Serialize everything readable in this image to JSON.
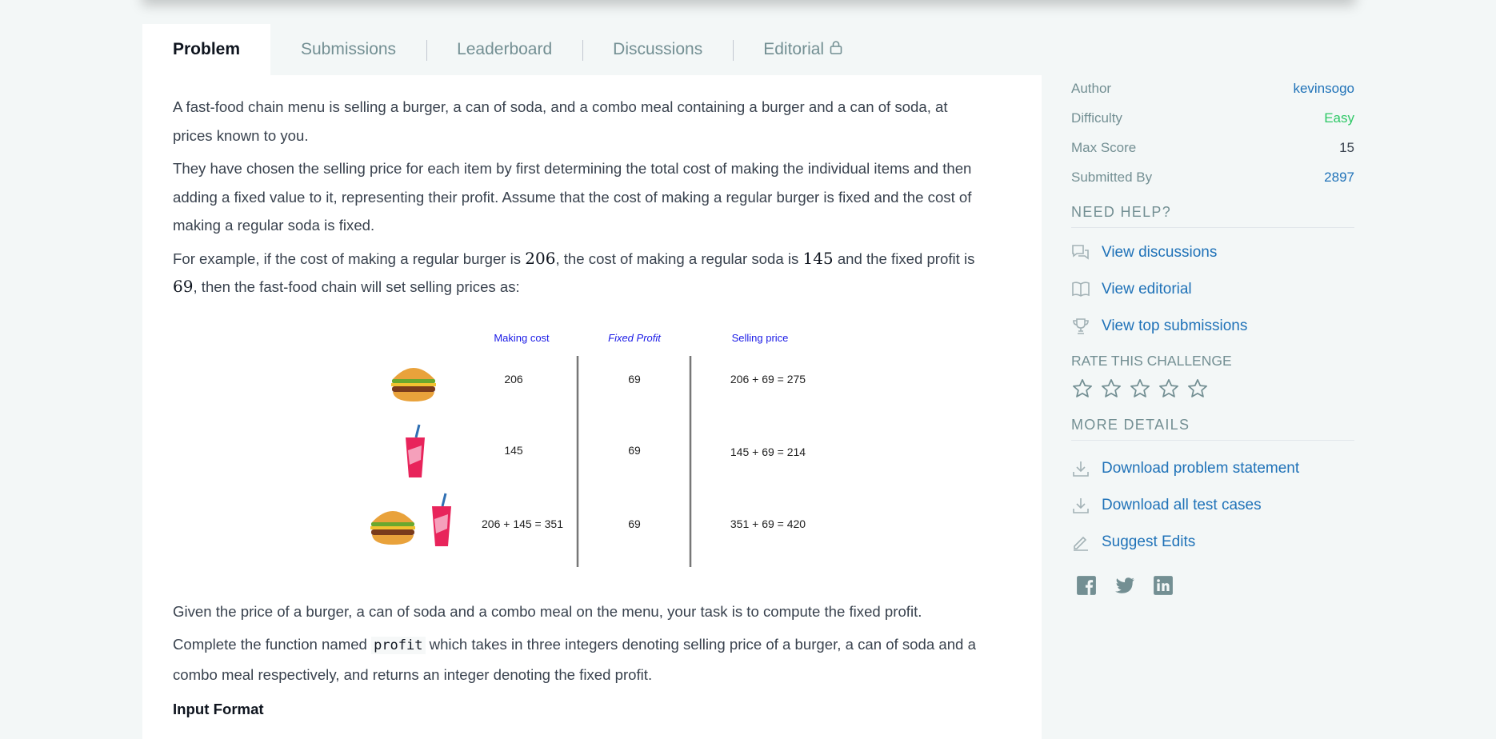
{
  "tabs": [
    {
      "label": "Problem",
      "active": true
    },
    {
      "label": "Submissions"
    },
    {
      "label": "Leaderboard"
    },
    {
      "label": "Discussions"
    },
    {
      "label": "Editorial"
    }
  ],
  "problem": {
    "p1": "A fast-food chain menu is selling a burger, a can of soda, and a combo meal containing a burger and a can of soda, at prices known to you.",
    "p2": "They have chosen the selling price for each item by first determining the total cost of making the individual items and then adding a fixed value to it, representing their profit. Assume that the cost of making a regular burger is fixed and the cost of making a regular soda is fixed.",
    "p3_a": "For example, if the cost of making a regular burger is ",
    "p3_n1": "206",
    "p3_b": ", the cost of making a regular soda is ",
    "p3_n2": "145",
    "p3_c": " and the fixed profit is ",
    "p3_n3": "69",
    "p3_d": ", then the fast-food chain will set selling prices as:",
    "p4": "Given the price of a burger, a can of soda and a combo meal on the menu, your task is to compute the fixed profit.",
    "p5_a": "Complete the function named ",
    "p5_code": "profit",
    "p5_b": " which takes in three integers denoting selling price of a burger, a can of soda and a combo meal respectively, and returns an integer denoting the fixed profit.",
    "input_format": "Input Format"
  },
  "figure": {
    "headers": [
      "Making cost",
      "Fixed Profit",
      "Selling price"
    ],
    "rows": [
      {
        "item": "burger",
        "making": "206",
        "profit": "69",
        "selling": "206 + 69 = 275"
      },
      {
        "item": "soda",
        "making": "145",
        "profit": "69",
        "selling": "145 + 69 = 214"
      },
      {
        "item": "combo",
        "making": "206 + 145 = 351",
        "profit": "69",
        "selling": "351 + 69 = 420"
      }
    ],
    "header_color": "#1a1ae6"
  },
  "sidebar": {
    "meta": [
      {
        "label": "Author",
        "value": "kevinsogo",
        "style": "link"
      },
      {
        "label": "Difficulty",
        "value": "Easy",
        "style": "easy"
      },
      {
        "label": "Max Score",
        "value": "15",
        "style": "plain"
      },
      {
        "label": "Submitted By",
        "value": "2897",
        "style": "link"
      }
    ],
    "need_help": "NEED HELP?",
    "help_links": [
      {
        "label": "View discussions",
        "icon": "discussion-icon"
      },
      {
        "label": "View editorial",
        "icon": "book-icon"
      },
      {
        "label": "View top submissions",
        "icon": "trophy-icon"
      }
    ],
    "rate_title": "RATE THIS CHALLENGE",
    "more_details": "MORE DETAILS",
    "detail_links": [
      {
        "label": "Download problem statement",
        "icon": "download-icon"
      },
      {
        "label": "Download all test cases",
        "icon": "download-icon"
      },
      {
        "label": "Suggest Edits",
        "icon": "pencil-icon"
      }
    ],
    "socials": [
      "facebook-icon",
      "twitter-icon",
      "linkedin-icon"
    ]
  },
  "colors": {
    "link": "#1f72b8",
    "easy": "#2ec866",
    "muted": "#738f93",
    "text": "#39424e"
  }
}
